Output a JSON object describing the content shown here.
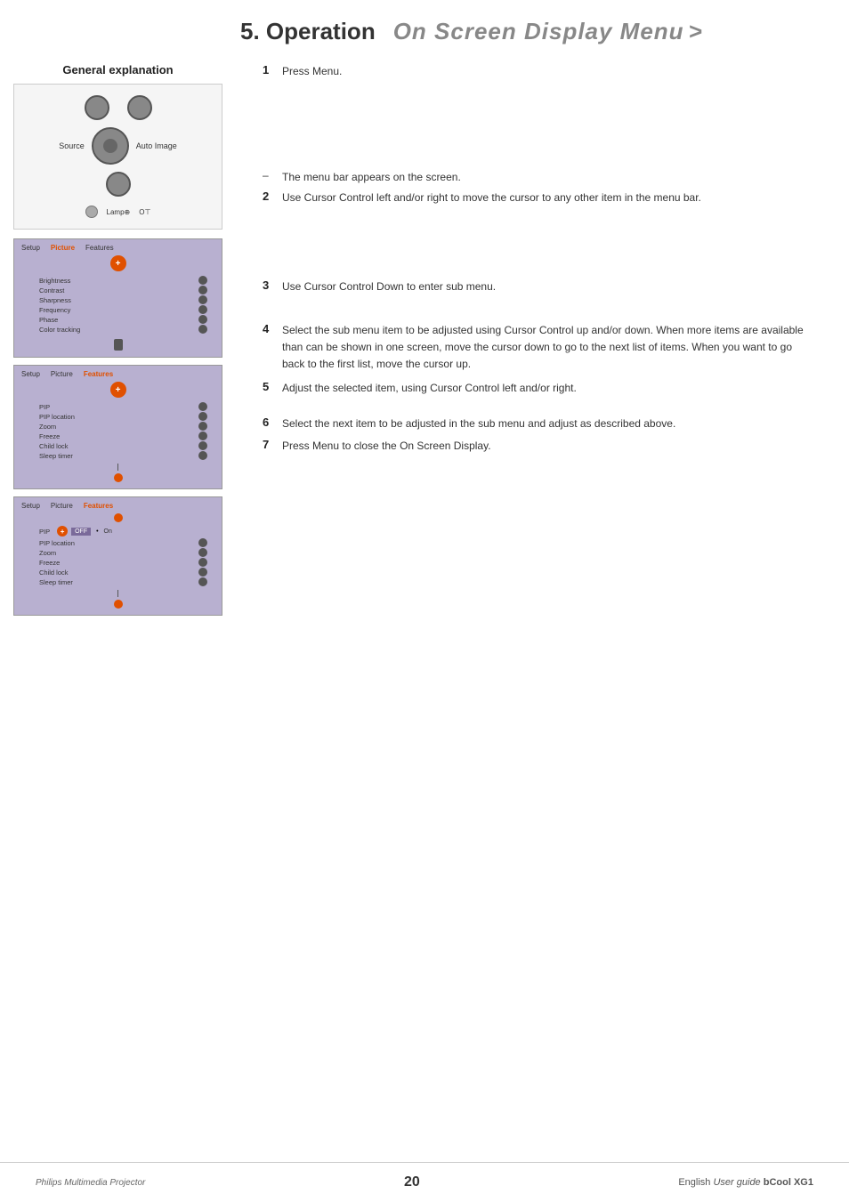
{
  "header": {
    "chapter": "5. Operation",
    "title": "On Screen Display Menu",
    "arrow": ">"
  },
  "left": {
    "section_title": "General explanation",
    "menu1": {
      "tabs": [
        "Setup",
        "Picture",
        "Features"
      ],
      "active_tab": "Picture",
      "icon_label": "+",
      "rows": [
        {
          "label": "Brightness",
          "icon": "normal"
        },
        {
          "label": "Contrast",
          "icon": "normal"
        },
        {
          "label": "Sharpness",
          "icon": "normal"
        },
        {
          "label": "Frequency",
          "icon": "normal"
        },
        {
          "label": "Phase",
          "icon": "normal"
        },
        {
          "label": "Color tracking",
          "icon": "normal"
        }
      ]
    },
    "menu2": {
      "tabs": [
        "Setup",
        "Picture",
        "Features"
      ],
      "active_tab": "Features",
      "icon_label": "+",
      "rows": [
        {
          "label": "PIP",
          "icon": "normal"
        },
        {
          "label": "PIP location",
          "icon": "normal"
        },
        {
          "label": "Zoom",
          "icon": "normal"
        },
        {
          "label": "Freeze",
          "icon": "normal"
        },
        {
          "label": "Child lock",
          "icon": "normal"
        },
        {
          "label": "Sleep timer",
          "icon": "normal"
        }
      ]
    },
    "menu3": {
      "tabs": [
        "Setup",
        "Picture",
        "Features"
      ],
      "active_tab": "Features",
      "icon_label": "+",
      "sub_row": {
        "label": "PIP",
        "selected": true,
        "options": [
          "OFF",
          "•",
          "On"
        ]
      },
      "rows": [
        {
          "label": "PIP location",
          "icon": "normal"
        },
        {
          "label": "Zoom",
          "icon": "normal"
        },
        {
          "label": "Freeze",
          "icon": "normal"
        },
        {
          "label": "Child lock",
          "icon": "normal"
        },
        {
          "label": "Sleep timer",
          "icon": "normal"
        }
      ]
    }
  },
  "right": {
    "step1": {
      "num": "1",
      "text": "Press Menu."
    },
    "dash1": {
      "symbol": "–",
      "text": "The menu bar appears on the screen."
    },
    "step2": {
      "num": "2",
      "text": "Use Cursor Control left and/or right to move the cursor to any other item in the menu bar."
    },
    "step3": {
      "num": "3",
      "text": "Use Cursor Control Down to enter sub menu."
    },
    "step4": {
      "num": "4",
      "text": "Select the sub menu item to be adjusted using Cursor Control up and/or down. When more items are available than can be shown in one screen, move the cursor down to go to the next list of items. When you want to go back to the first list, move the cursor up."
    },
    "step5": {
      "num": "5",
      "text": "Adjust the selected item, using Cursor Control left and/or right."
    },
    "step6": {
      "num": "6",
      "text": "Select the next item to be adjusted in the sub menu and adjust as described above."
    },
    "step7": {
      "num": "7",
      "text": "Press Menu to close the On Screen Display."
    }
  },
  "footer": {
    "left": "Philips Multimedia Projector",
    "center": "20",
    "right_plain": "English",
    "right_italic": "User guide",
    "right_bold": "bCool XG1"
  }
}
